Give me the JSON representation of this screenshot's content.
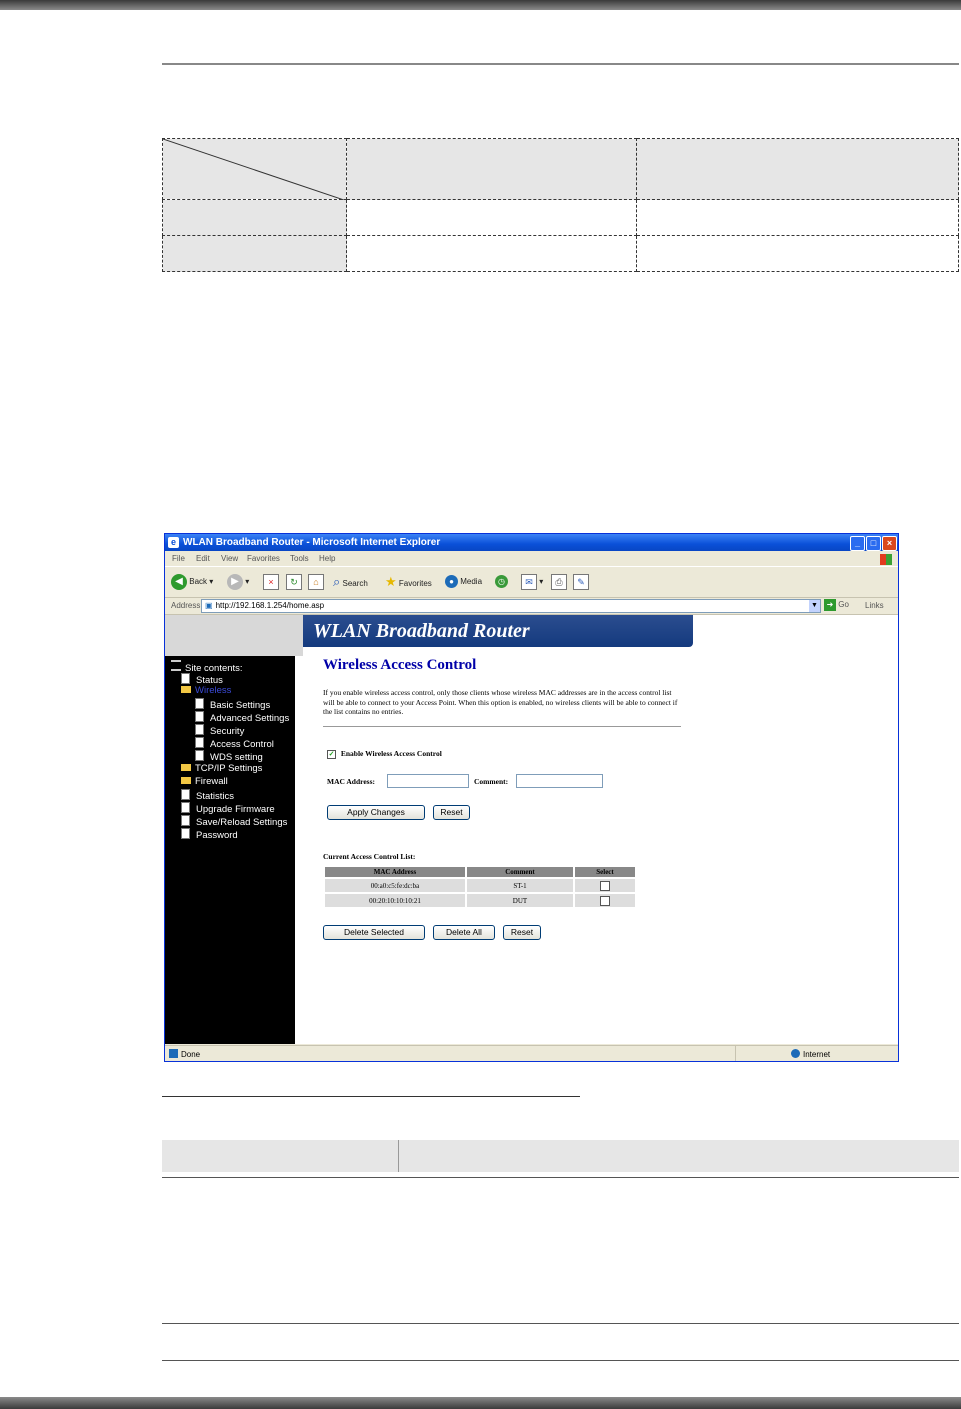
{
  "browser": {
    "title": "WLAN Broadband Router - Microsoft Internet Explorer",
    "menu": [
      "File",
      "Edit",
      "View",
      "Favorites",
      "Tools",
      "Help"
    ],
    "toolbar": {
      "back": "Back",
      "search": "Search",
      "favorites": "Favorites",
      "media": "Media"
    },
    "address_label": "Address",
    "url": "http://192.168.1.254/home.asp",
    "go": "Go",
    "links": "Links",
    "status": "Done",
    "zone": "Internet"
  },
  "router": {
    "banner": "WLAN Broadband Router",
    "sidebar": {
      "heading": "Site contents:",
      "items": [
        "Status",
        "Wireless",
        "Basic Settings",
        "Advanced Settings",
        "Security",
        "Access Control",
        "WDS setting",
        "TCP/IP Settings",
        "Firewall",
        "Statistics",
        "Upgrade Firmware",
        "Save/Reload Settings",
        "Password"
      ]
    },
    "page": {
      "title": "Wireless Access Control",
      "description": "If you enable wireless access control, only those clients whose wireless MAC addresses are in the access control list will be able to connect to your Access Point. When this option is enabled, no wireless clients will be able to connect if the list contains no entries.",
      "enable_label": "Enable Wireless Access Control",
      "mac_label": "MAC Address:",
      "comment_label": "Comment:",
      "apply_button": "Apply Changes",
      "reset_button": "Reset",
      "list_title": "Current Access Control List:",
      "columns": [
        "MAC Address",
        "Comment",
        "Select"
      ],
      "rows": [
        {
          "mac": "00:a0:c5:fe:dc:ba",
          "comment": "ST-1"
        },
        {
          "mac": "00:20:10:10:10:21",
          "comment": "DUT"
        }
      ],
      "delete_selected": "Delete Selected",
      "delete_all": "Delete All",
      "reset2": "Reset"
    }
  }
}
